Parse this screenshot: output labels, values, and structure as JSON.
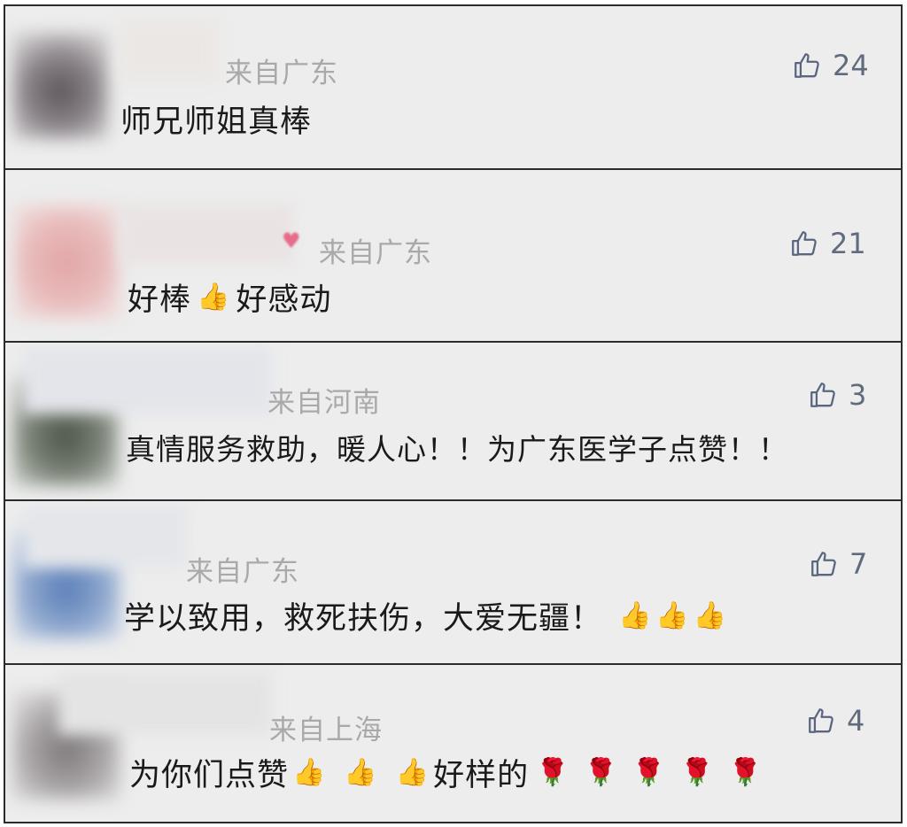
{
  "comments": [
    {
      "location": "来自广东",
      "likes": "24",
      "text": "师兄师姐真棒"
    },
    {
      "location": "来自广东",
      "likes": "21",
      "text_a": "好棒",
      "text_b": "好感动",
      "emoji": "👍"
    },
    {
      "location": "来自河南",
      "likes": "3",
      "text": "真情服务救助，暖人心！！为广东医学子点赞！！"
    },
    {
      "location": "来自广东",
      "likes": "7",
      "text": "学以致用，救死扶伤，大爱无疆！",
      "emojis": [
        "👍",
        "👍",
        "👍"
      ]
    },
    {
      "location": "来自上海",
      "likes": "4",
      "text_a": "为你们点赞",
      "text_b": "好样的",
      "thumbs": [
        "👍",
        "👍",
        "👍"
      ],
      "roses": [
        "🌹",
        "🌹",
        "🌹",
        "🌹",
        "🌹"
      ]
    }
  ],
  "icons": {
    "like": "thumbs-up-icon"
  },
  "colors": {
    "card_bg": "#ededed",
    "border": "#2b2b2b",
    "location": "#a9a9a9",
    "like": "#606b7d"
  }
}
